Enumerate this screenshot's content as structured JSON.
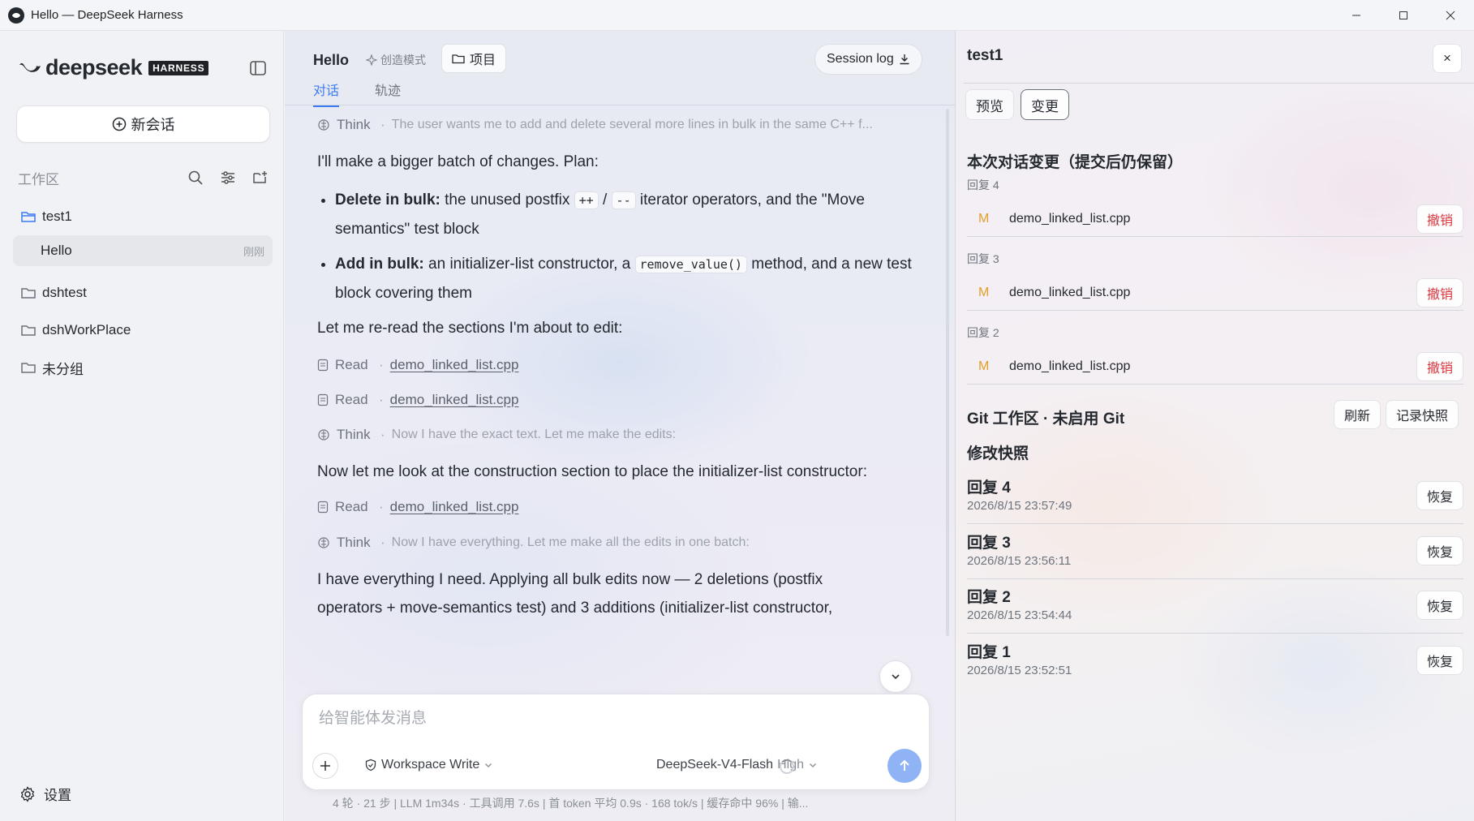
{
  "window": {
    "title": "Hello — DeepSeek Harness"
  },
  "sidebar": {
    "brand": "deepseek",
    "badge": "HARNESS",
    "new_chat": "新会话",
    "workspace_label": "工作区",
    "tree": [
      {
        "label": "test1",
        "type": "folder-open"
      },
      {
        "label": "Hello",
        "time": "刚刚",
        "type": "chat"
      },
      {
        "label": "dshtest",
        "type": "folder"
      },
      {
        "label": "dshWorkPlace",
        "type": "folder"
      },
      {
        "label": "未分组",
        "type": "folder"
      }
    ],
    "settings": "设置"
  },
  "main": {
    "title": "Hello",
    "mode": "创造模式",
    "project_button": "项目",
    "session_log": "Session log",
    "tabs": [
      "对话",
      "轨迹"
    ],
    "think1": {
      "label": "Think",
      "text": "The user wants me to add and delete several more lines in bulk in the same C++ f..."
    },
    "p1": "I'll make a bigger batch of changes. Plan:",
    "bullet1": {
      "bold": "Delete in bulk:",
      "t1": " the unused postfix ",
      "code1": "++",
      "slash": " / ",
      "code2": "--",
      "t2": " iterator operators, and the \"Move semantics\" test block"
    },
    "bullet2": {
      "bold": "Add in bulk:",
      "t1": " an initializer-list constructor, a ",
      "code1": "remove_value()",
      "t2": " method, and a new test block covering them"
    },
    "p2": "Let me re-read the sections I'm about to edit:",
    "read1": {
      "label": "Read",
      "file": "demo_linked_list.cpp"
    },
    "read2": {
      "label": "Read",
      "file": "demo_linked_list.cpp"
    },
    "think2": {
      "label": "Think",
      "text": "Now I have the exact text. Let me make the edits:"
    },
    "p3": "Now let me look at the construction section to place the initializer-list constructor:",
    "read3": {
      "label": "Read",
      "file": "demo_linked_list.cpp"
    },
    "think3": {
      "label": "Think",
      "text": "Now I have everything. Let me make all the edits in one batch:"
    },
    "p4": "I have everything I need. Applying all bulk edits now — 2 deletions (postfix operators + move-semantics test) and 3 additions (initializer-list constructor,",
    "composer": {
      "placeholder": "给智能体发消息",
      "permission": "Workspace Write",
      "model": "DeepSeek-V4-Flash",
      "level": "High"
    },
    "stats": "4 轮 · 21 步   |   LLM 1m34s · 工具调用 7.6s   |   首 token 平均 0.9s · 168 tok/s   |   缓存命中 96%   |   输..."
  },
  "panel": {
    "title": "test1",
    "close": "×",
    "tabs": [
      "预览",
      "变更"
    ],
    "changes_title": "本次对话变更（提交后仍保留）",
    "changes": [
      {
        "reply": "回复 4",
        "status": "M",
        "file": "demo_linked_list.cpp",
        "action": "撤销"
      },
      {
        "reply": "回复 3",
        "status": "M",
        "file": "demo_linked_list.cpp",
        "action": "撤销"
      },
      {
        "reply": "回复 2",
        "status": "M",
        "file": "demo_linked_list.cpp",
        "action": "撤销"
      }
    ],
    "git_title": "Git 工作区 · 未启用 Git",
    "refresh": "刷新",
    "snapshot_btn": "记录快照",
    "snapshots_title": "修改快照",
    "snapshots": [
      {
        "name": "回复 4",
        "time": "2026/8/15 23:57:49",
        "action": "恢复"
      },
      {
        "name": "回复 3",
        "time": "2026/8/15 23:56:11",
        "action": "恢复"
      },
      {
        "name": "回复 2",
        "time": "2026/8/15 23:54:44",
        "action": "恢复"
      },
      {
        "name": "回复 1",
        "time": "2026/8/15 23:52:51",
        "action": "恢复"
      }
    ]
  },
  "colors": {
    "accent": "#3b7bf0",
    "danger": "#d9363e",
    "modified": "#e2a02a",
    "send": "#8fb3f5"
  }
}
